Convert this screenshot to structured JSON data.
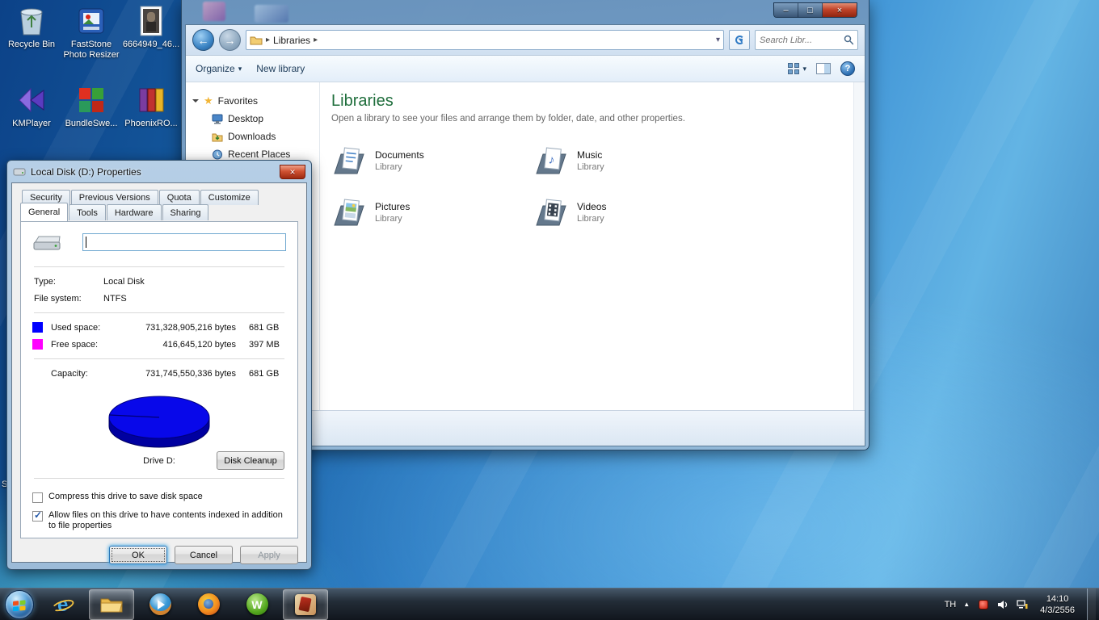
{
  "icons": {
    "back_arrow": "←",
    "forward_arrow": "→",
    "breadcrumb_arrow": "▸",
    "dropdown_arrow": "▾",
    "star": "★",
    "music_note": "♪",
    "help_glyph": "?",
    "check": "✓",
    "minimize": "–",
    "maximize": "□",
    "close": "×",
    "up_arrow": "▲",
    "ie_logo": "e",
    "w_logo": "W"
  },
  "desktop": {
    "icons": [
      {
        "label": "Recycle Bin"
      },
      {
        "label": "FastStone Photo Resizer"
      },
      {
        "label": "6664949_46..."
      },
      {
        "label": "KMPlayer"
      },
      {
        "label": "BundleSwe..."
      },
      {
        "label": "PhoenixRO..."
      }
    ],
    "stray_label": "S"
  },
  "explorer": {
    "breadcrumb": "Libraries",
    "search_placeholder": "Search Libr...",
    "toolbar": {
      "organize_label": "Organize",
      "new_library_label": "New library"
    },
    "sidebar": {
      "favorites_label": "Favorites",
      "items": [
        {
          "label": "Desktop"
        },
        {
          "label": "Downloads"
        },
        {
          "label": "Recent Places"
        }
      ]
    },
    "main": {
      "title": "Libraries",
      "subtitle": "Open a library to see your files and arrange them by folder, date, and other properties.",
      "items": [
        {
          "name": "Documents",
          "kind": "Library"
        },
        {
          "name": "Music",
          "kind": "Library"
        },
        {
          "name": "Pictures",
          "kind": "Library"
        },
        {
          "name": "Videos",
          "kind": "Library"
        }
      ]
    }
  },
  "dialog": {
    "title": "Local Disk (D:) Properties",
    "tabs_back": [
      {
        "label": "Security"
      },
      {
        "label": "Previous Versions"
      },
      {
        "label": "Quota"
      },
      {
        "label": "Customize"
      }
    ],
    "tabs_front": [
      {
        "label": "General"
      },
      {
        "label": "Tools"
      },
      {
        "label": "Hardware"
      },
      {
        "label": "Sharing"
      }
    ],
    "general": {
      "drive_name_value": "",
      "type_label": "Type:",
      "type_value": "Local Disk",
      "filesystem_label": "File system:",
      "filesystem_value": "NTFS",
      "used_label": "Used space:",
      "used_bytes": "731,328,905,216 bytes",
      "used_size": "681 GB",
      "free_label": "Free space:",
      "free_bytes": "416,645,120 bytes",
      "free_size": "397 MB",
      "capacity_label": "Capacity:",
      "capacity_bytes": "731,745,550,336 bytes",
      "capacity_size": "681 GB",
      "drive_caption": "Drive D:",
      "disk_cleanup_label": "Disk Cleanup",
      "compress_label": "Compress this drive to save disk space",
      "index_label": "Allow files on this drive to have contents indexed in addition to file properties"
    },
    "buttons": {
      "ok": "OK",
      "cancel": "Cancel",
      "apply": "Apply"
    }
  },
  "taskbar": {
    "tray": {
      "language": "TH",
      "time": "14:10",
      "date": "4/3/2556"
    }
  },
  "chart_data": {
    "type": "pie",
    "title": "Drive D: space usage",
    "slices": [
      {
        "label": "Used space",
        "bytes": 731328905216,
        "display": "681 GB",
        "color": "#0000ff"
      },
      {
        "label": "Free space",
        "bytes": 416645120,
        "display": "397 MB",
        "color": "#ff00ff"
      }
    ]
  }
}
